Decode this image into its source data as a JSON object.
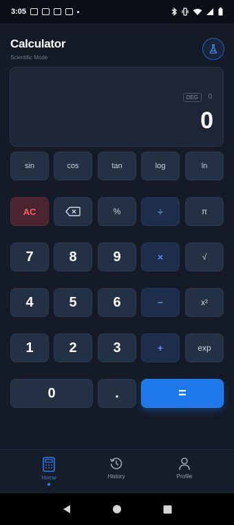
{
  "status_bar": {
    "time": "3:05"
  },
  "header": {
    "title": "Calculator",
    "subtitle": "Scientific Mode"
  },
  "display": {
    "angle_mode": "DEG",
    "memory": "0",
    "value": "0"
  },
  "scientific_keys": [
    "sin",
    "cos",
    "tan",
    "log",
    "ln"
  ],
  "keys": {
    "clear": "AC",
    "percent": "%",
    "divide": "÷",
    "pi": "π",
    "seven": "7",
    "eight": "8",
    "nine": "9",
    "multiply": "×",
    "sqrt": "√",
    "four": "4",
    "five": "5",
    "six": "6",
    "minus": "−",
    "square": "x²",
    "one": "1",
    "two": "2",
    "three": "3",
    "plus": "+",
    "exp": "exp",
    "zero": "0",
    "decimal": ".",
    "equals": "="
  },
  "bottom_nav": {
    "home": "Home",
    "history": "History",
    "profile": "Profile"
  },
  "colors": {
    "accent": "#1f78ea",
    "clear": "#ff5c66",
    "background": "#141b26"
  }
}
